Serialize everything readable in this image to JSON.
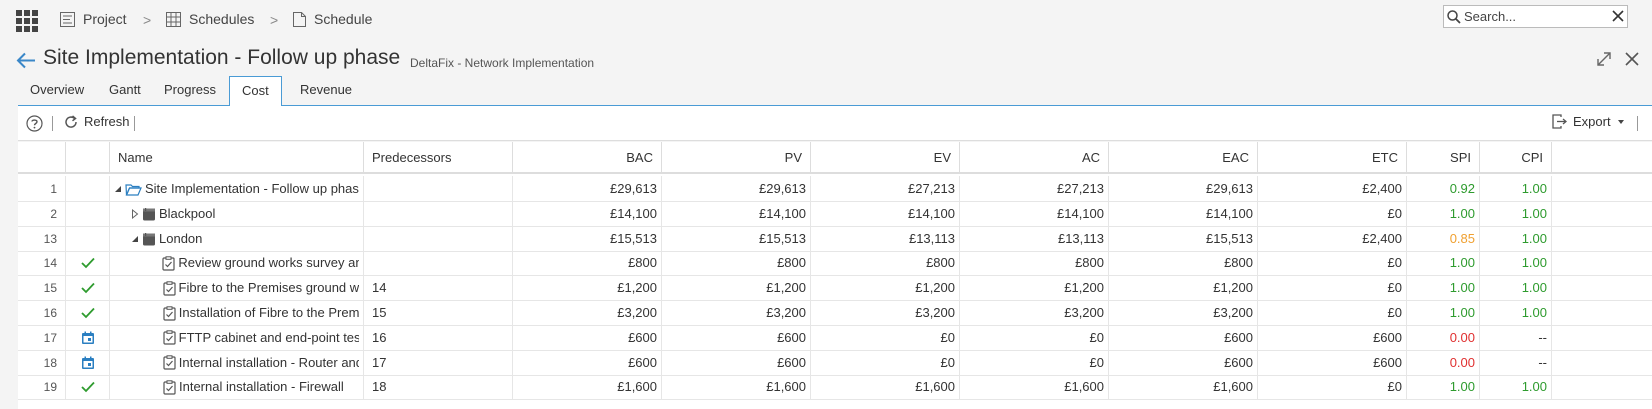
{
  "breadcrumb": {
    "items": [
      {
        "label": "Project",
        "icon": "project-icon"
      },
      {
        "label": "Schedules",
        "icon": "schedules-grid-icon"
      },
      {
        "label": "Schedule",
        "icon": "document-icon"
      }
    ],
    "separator": ">"
  },
  "search": {
    "placeholder": "Search...",
    "value": ""
  },
  "page": {
    "title": "Site Implementation - Follow up phase",
    "subtitle": "DeltaFix - Network Implementation"
  },
  "tabs": [
    {
      "label": "Overview",
      "active": false
    },
    {
      "label": "Gantt",
      "active": false
    },
    {
      "label": "Progress",
      "active": false
    },
    {
      "label": "Cost",
      "active": true
    },
    {
      "label": "Revenue",
      "active": false
    }
  ],
  "toolbar": {
    "refresh_label": "Refresh",
    "export_label": "Export"
  },
  "colors": {
    "accent": "#4a9bd5",
    "good": "#2e9b2e",
    "warning": "#f0a030",
    "bad": "#e03030"
  },
  "table": {
    "columns": [
      "",
      "",
      "Name",
      "Predecessors",
      "BAC",
      "PV",
      "EV",
      "AC",
      "EAC",
      "ETC",
      "SPI",
      "CPI"
    ],
    "rows": [
      {
        "id": "1",
        "status": "",
        "level": 0,
        "expander": "expanded",
        "icon": "folder-open-icon",
        "name": "Site Implementation - Follow up phase",
        "pred": "",
        "bac": "£29,613",
        "pv": "£29,613",
        "ev": "£27,213",
        "ac": "£27,213",
        "eac": "£29,613",
        "etc": "£2,400",
        "spi": "0.92",
        "spi_color": "good",
        "cpi": "1.00",
        "cpi_color": "good"
      },
      {
        "id": "2",
        "status": "",
        "level": 1,
        "expander": "collapsed",
        "icon": "package-icon",
        "name": "Blackpool",
        "pred": "",
        "bac": "£14,100",
        "pv": "£14,100",
        "ev": "£14,100",
        "ac": "£14,100",
        "eac": "£14,100",
        "etc": "£0",
        "spi": "1.00",
        "spi_color": "good",
        "cpi": "1.00",
        "cpi_color": "good"
      },
      {
        "id": "13",
        "status": "",
        "level": 1,
        "expander": "expanded",
        "icon": "package-icon",
        "name": "London",
        "pred": "",
        "bac": "£15,513",
        "pv": "£15,513",
        "ev": "£13,113",
        "ac": "£13,113",
        "eac": "£15,513",
        "etc": "£2,400",
        "spi": "0.85",
        "spi_color": "warning",
        "cpi": "1.00",
        "cpi_color": "good"
      },
      {
        "id": "14",
        "status": "check",
        "level": 2,
        "expander": "",
        "icon": "task-icon",
        "name": "Review ground works survey and",
        "pred": "",
        "bac": "£800",
        "pv": "£800",
        "ev": "£800",
        "ac": "£800",
        "eac": "£800",
        "etc": "£0",
        "spi": "1.00",
        "spi_color": "good",
        "cpi": "1.00",
        "cpi_color": "good"
      },
      {
        "id": "15",
        "status": "check",
        "level": 2,
        "expander": "",
        "icon": "task-icon",
        "name": "Fibre to the Premises ground wo",
        "pred": "14",
        "bac": "£1,200",
        "pv": "£1,200",
        "ev": "£1,200",
        "ac": "£1,200",
        "eac": "£1,200",
        "etc": "£0",
        "spi": "1.00",
        "spi_color": "good",
        "cpi": "1.00",
        "cpi_color": "good"
      },
      {
        "id": "16",
        "status": "check",
        "level": 2,
        "expander": "",
        "icon": "task-icon",
        "name": "Installation of Fibre to the Premi",
        "pred": "15",
        "bac": "£3,200",
        "pv": "£3,200",
        "ev": "£3,200",
        "ac": "£3,200",
        "eac": "£3,200",
        "etc": "£0",
        "spi": "1.00",
        "spi_color": "good",
        "cpi": "1.00",
        "cpi_color": "good"
      },
      {
        "id": "17",
        "status": "calendar",
        "level": 2,
        "expander": "",
        "icon": "task-icon",
        "name": "FTTP cabinet and end-point test",
        "pred": "16",
        "bac": "£600",
        "pv": "£600",
        "ev": "£0",
        "ac": "£0",
        "eac": "£600",
        "etc": "£600",
        "spi": "0.00",
        "spi_color": "bad",
        "cpi": "--",
        "cpi_color": "none"
      },
      {
        "id": "18",
        "status": "calendar",
        "level": 2,
        "expander": "",
        "icon": "task-icon",
        "name": "Internal installation - Router and",
        "pred": "17",
        "bac": "£600",
        "pv": "£600",
        "ev": "£0",
        "ac": "£0",
        "eac": "£600",
        "etc": "£600",
        "spi": "0.00",
        "spi_color": "bad",
        "cpi": "--",
        "cpi_color": "none"
      },
      {
        "id": "19",
        "status": "check",
        "level": 2,
        "expander": "",
        "icon": "task-icon",
        "name": "Internal installation - Firewall",
        "pred": "18",
        "bac": "£1,600",
        "pv": "£1,600",
        "ev": "£1,600",
        "ac": "£1,600",
        "eac": "£1,600",
        "etc": "£0",
        "spi": "1.00",
        "spi_color": "good",
        "cpi": "1.00",
        "cpi_color": "good"
      }
    ]
  }
}
